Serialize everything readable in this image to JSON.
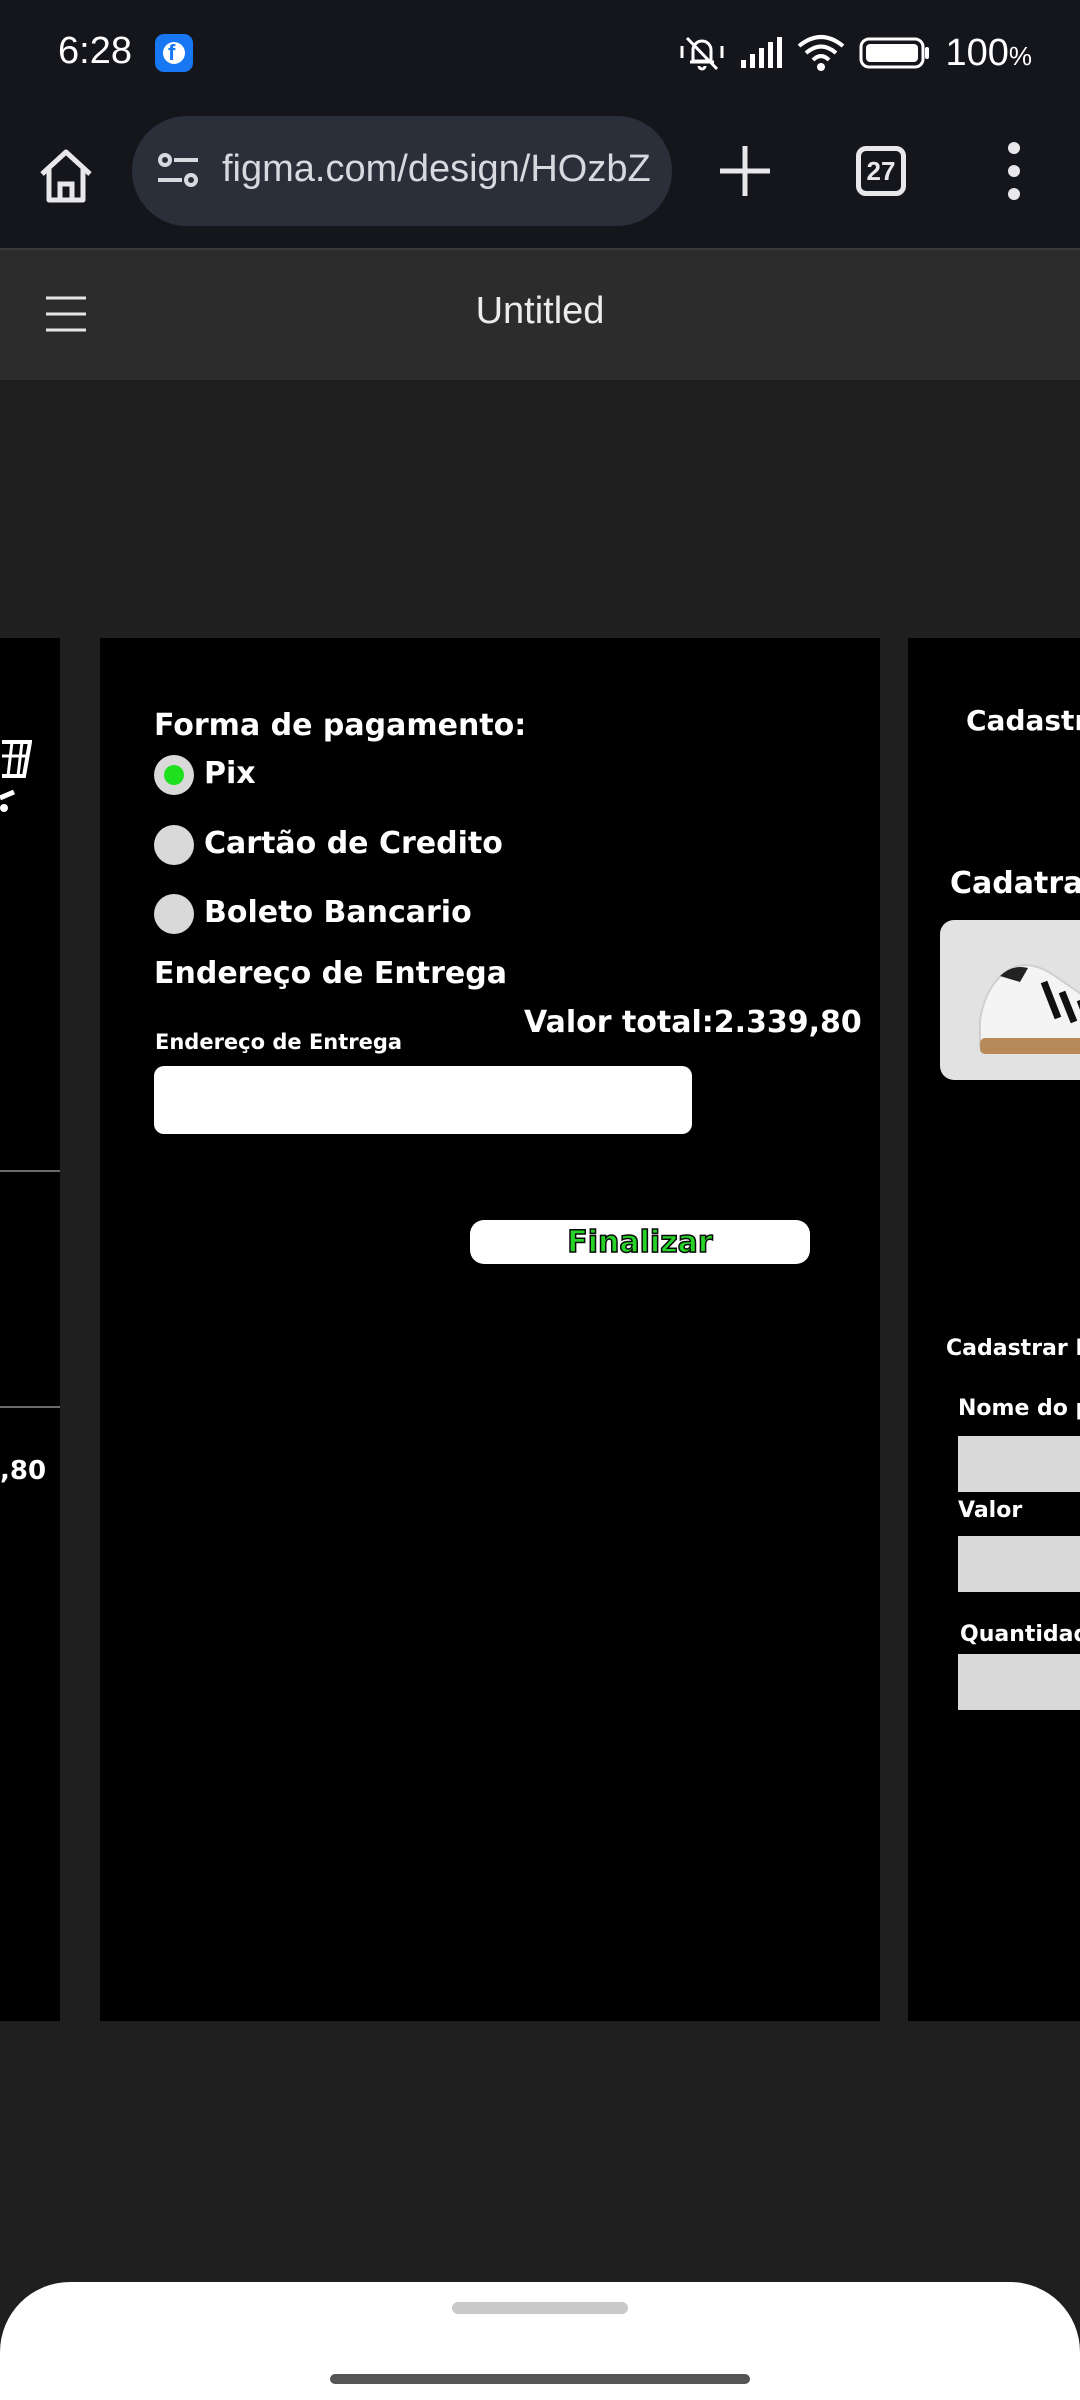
{
  "status_bar": {
    "time": "6:28",
    "app_badge": "f",
    "battery_percent": "100",
    "battery_unit": "%"
  },
  "browser": {
    "url": "figma.com/design/HOzbZe",
    "tab_count": "27"
  },
  "figma": {
    "title": "Untitled"
  },
  "left_frame": {
    "value_fragment": ",80"
  },
  "payment_frame": {
    "payment_heading": "Forma de pagamento:",
    "options": [
      {
        "label": "Pix",
        "selected": true
      },
      {
        "label": "Cartão de Credito",
        "selected": false
      },
      {
        "label": "Boleto Bancario",
        "selected": false
      }
    ],
    "address_heading": "Endereço de Entrega",
    "total": "Valor total:2.339,80",
    "address_field_label": "Endereço de Entrega",
    "address_value": "",
    "finalize_label": "Finalizar"
  },
  "right_frame": {
    "title_1": "Cadastr",
    "title_2": "Cadatrac",
    "section": "Cadastrar N",
    "field_1_label": "Nome do p",
    "field_2_label": "Valor",
    "field_3_label": "Quantidad"
  },
  "colors": {
    "accent_green": "#1fe01f",
    "finalize_green": "#27d327",
    "canvas_bg": "#1f1f20",
    "frame_bg": "#000000"
  }
}
